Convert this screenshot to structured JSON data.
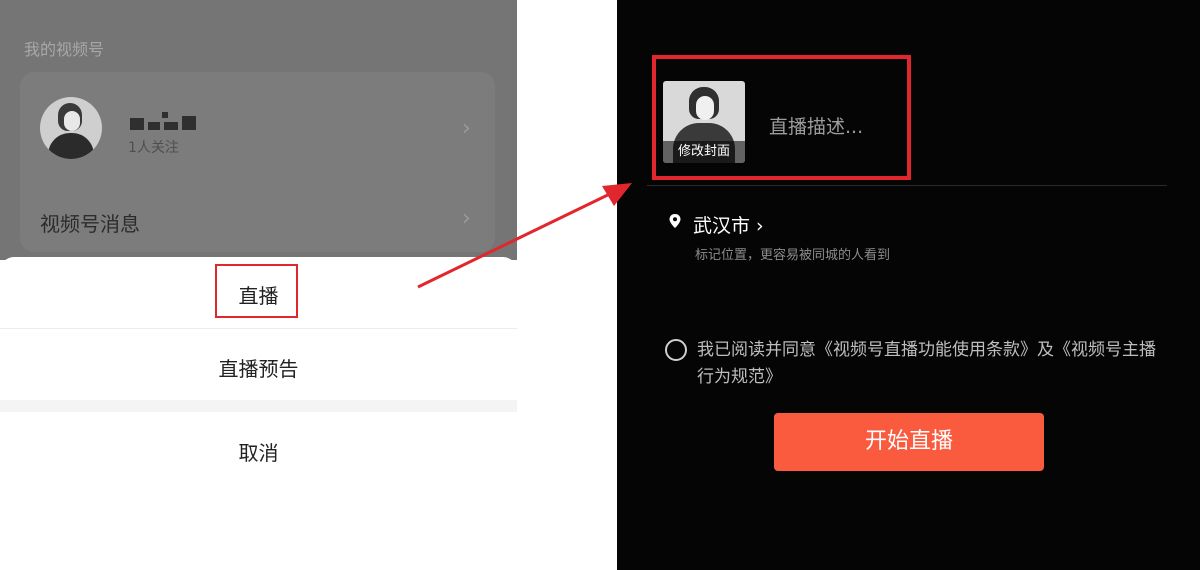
{
  "left_screen": {
    "section_title": "我的视频号",
    "profile": {
      "followers": "1人关注"
    },
    "messages_label": "视频号消息",
    "sheet": {
      "live_label": "直播",
      "live_preview_label": "直播预告",
      "cancel_label": "取消"
    }
  },
  "right_screen": {
    "cover": {
      "edit_label": "修改封面"
    },
    "description_placeholder": "直播描述...",
    "location": {
      "city": "武汉市 ›",
      "hint": "标记位置，更容易被同城的人看到"
    },
    "agreement": {
      "text": "我已阅读并同意《视频号直播功能使用条款》及《视频号主播行为规范》"
    },
    "start_button_label": "开始直播"
  },
  "colors": {
    "highlight": "#e2262e",
    "start_button": "#fa5b3e",
    "dark_bg": "#050505"
  }
}
